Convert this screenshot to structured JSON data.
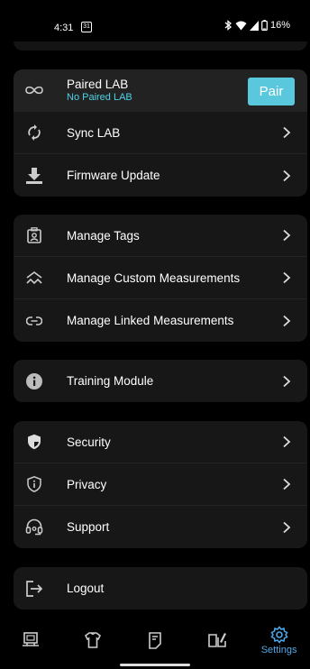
{
  "status_bar": {
    "time": "4:31",
    "calendar_day": "31",
    "battery": "16%"
  },
  "lab_card": {
    "paired_label": "Paired LAB",
    "paired_sub": "No Paired LAB",
    "pair_button": "Pair",
    "sync_label": "Sync LAB",
    "firmware_label": "Firmware Update"
  },
  "manage_card": {
    "tags_label": "Manage Tags",
    "custom_label": "Manage Custom Measurements",
    "linked_label": "Manage Linked Measurements"
  },
  "training_card": {
    "training_label": "Training Module"
  },
  "security_card": {
    "security_label": "Security",
    "privacy_label": "Privacy",
    "support_label": "Support"
  },
  "logout_card": {
    "logout_label": "Logout"
  },
  "bottom_nav": {
    "settings_label": "Settings",
    "active_color": "#4fa8e8",
    "icons": [
      "monitor-icon",
      "shirt-icon",
      "document-icon",
      "book-icon",
      "gear-icon"
    ]
  },
  "colors": {
    "accent": "#5ac8dc",
    "subtext": "#4fd1e6",
    "card": "#171717"
  }
}
